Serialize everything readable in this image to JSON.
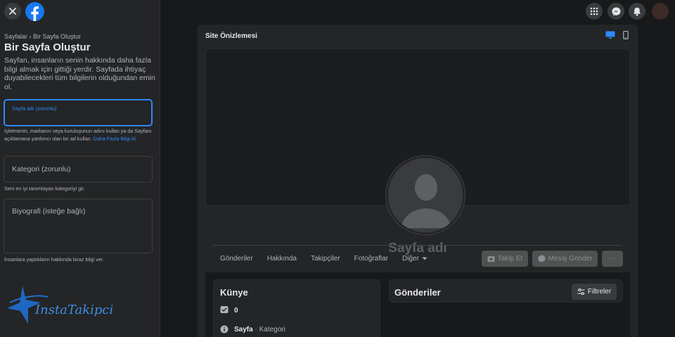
{
  "sidebar": {
    "breadcrumb": "Sayfalar › Bir Sayfa Oluştur",
    "title": "Bir Sayfa Oluştur",
    "intro": "Sayfan, insanların senin hakkında daha fazla bilgi almak için gittiği yerdir. Sayfada ihtiyaç duyabilecekleri tüm bilgilerin olduğundan emin ol.",
    "name_field_label": "Sayfa adı (zorunlu)",
    "name_help": "İşletmenin, markanın veya kuruluşunun adını kullan ya da Sayfanı açıklamana yardımcı olan bir ad kullan. ",
    "name_help_link": "Daha Fazla Bilgi Al",
    "category_placeholder": "Kategori (zorunlu)",
    "category_help": "Seni en iyi tanımlayan kategoriyi gir.",
    "bio_placeholder": "Biyografi (isteğe bağlı)",
    "bio_help": "İnsanlara yaptıkların hakkında biraz bilgi ver.",
    "watermark": "InstaTakipci"
  },
  "preview": {
    "title": "Site Önizlemesi",
    "page_name": "Sayfa adı",
    "tabs": [
      "Gönderiler",
      "Hakkında",
      "Takipçiler",
      "Fotoğraflar",
      "Diğer"
    ],
    "follow_label": "Takip Et",
    "message_label": "Mesaj Gönder",
    "more_label": "···",
    "kunye_title": "Künye",
    "followers_count": "0",
    "page_label": "Sayfa",
    "category_label": " · Kategori",
    "posts_title": "Gönderiler",
    "filters_label": "Filtreler"
  },
  "colors": {
    "accent": "#2d88ff",
    "brand": "#1877f2",
    "background": "#18191a",
    "surface": "#242526"
  },
  "icons": [
    "close-icon",
    "facebook-logo",
    "menu-grid-icon",
    "messenger-icon",
    "notification-bell-icon",
    "desktop-icon",
    "mobile-icon",
    "chevron-down-icon",
    "follow-icon",
    "messenger-icon",
    "check-icon",
    "info-icon",
    "filter-icon"
  ]
}
